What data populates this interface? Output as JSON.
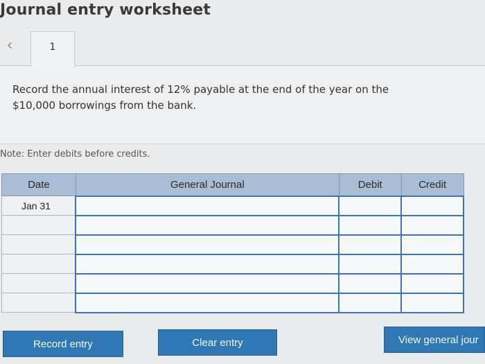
{
  "header": {
    "title": "Journal entry worksheet"
  },
  "tabs": {
    "back_icon": "chevron-left-icon",
    "active_tab": "1"
  },
  "question": {
    "line1": "Record the annual interest of 12% payable at the end of the year on the",
    "line2": "$10,000 borrowings from the bank."
  },
  "note": "Note: Enter debits before credits.",
  "table": {
    "columns": [
      "Date",
      "General Journal",
      "Debit",
      "Credit"
    ],
    "rows": [
      {
        "date": "Jan 31",
        "account": "",
        "debit": "",
        "credit": ""
      },
      {
        "date": "",
        "account": "",
        "debit": "",
        "credit": ""
      },
      {
        "date": "",
        "account": "",
        "debit": "",
        "credit": ""
      },
      {
        "date": "",
        "account": "",
        "debit": "",
        "credit": ""
      },
      {
        "date": "",
        "account": "",
        "debit": "",
        "credit": ""
      },
      {
        "date": "",
        "account": "",
        "debit": "",
        "credit": ""
      }
    ]
  },
  "buttons": {
    "record": "Record entry",
    "clear": "Clear entry",
    "view": "View general jour"
  },
  "colors": {
    "header_bg": "#a9bed4",
    "button_bg": "#2f78b5",
    "input_border": "#3b73b3"
  }
}
